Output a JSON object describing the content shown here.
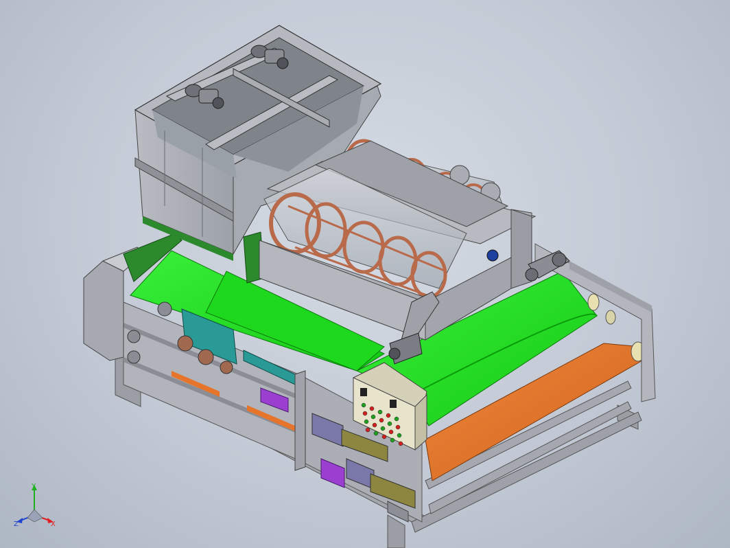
{
  "viewport": {
    "background": "#c8cfd9"
  },
  "model": {
    "parts": [
      "frame",
      "hopper-tank",
      "rotary-drum-screen",
      "green-belt",
      "orange-belt",
      "control-panel",
      "gear-motors",
      "rollers"
    ],
    "colors": {
      "frame": "#a9acb2",
      "belt_green": "#22e022",
      "belt_orange": "#e6742a",
      "drum_rings": "#b86a4a",
      "panel": "#e8e4cc",
      "motor_purple": "#9a3fd0",
      "motor_olive": "#8c8640",
      "teal_roller": "#2a9a96",
      "green_stand": "#2c8a2c"
    }
  },
  "triad": {
    "x_label": "X",
    "y_label": "Y",
    "z_label": "Z",
    "x_color": "#e02020",
    "y_color": "#20b020",
    "z_color": "#2040d0"
  }
}
